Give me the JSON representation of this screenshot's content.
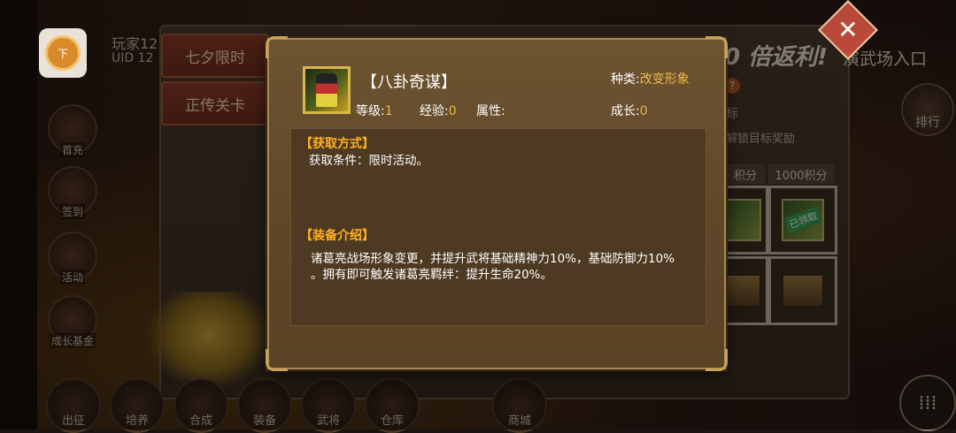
{
  "player": {
    "name": "玩家12",
    "uid": "UID 12",
    "avatar_char": "下"
  },
  "left_menu": [
    {
      "label": "首充"
    },
    {
      "label": "签到"
    },
    {
      "label": "活动"
    },
    {
      "label": "成长基金"
    }
  ],
  "bottom_menu": [
    {
      "label": "出征"
    },
    {
      "label": "培养"
    },
    {
      "label": "合成"
    },
    {
      "label": "装备"
    },
    {
      "label": "武将"
    },
    {
      "label": "仓库"
    },
    {
      "label": "商城"
    }
  ],
  "event": {
    "tabs": [
      "七夕限时",
      "正传关卡"
    ],
    "rebate_text": "0 倍返利!",
    "entrance_text": "演武场入口",
    "goal_text": "标",
    "unlock_text": "解锁目标奖励",
    "score_headers": [
      "积分",
      "1000积分"
    ],
    "claimed_label": "已领取",
    "rank_label": "排行"
  },
  "modal": {
    "title": "【八卦奇谋】",
    "type_label": "种类:",
    "type_value": "改变形象",
    "level_label": "等级:",
    "level_value": "1",
    "exp_label": "经验:",
    "exp_value": "0",
    "attr_label": "属性:",
    "attr_value": "",
    "growth_label": "成长:",
    "growth_value": "0",
    "acquire_head": "【获取方式】",
    "acquire_body": "获取条件：限时活动。",
    "intro_head": "【装备介绍】",
    "intro_line1": "诸葛亮战场形象变更，并提升武将基础精神力10%，基础防御力10%",
    "intro_line2": "。拥有即可触发诸葛亮羁绊：提升生命20%。"
  },
  "colors": {
    "accent_gold": "#f2b94a",
    "section_orange": "#ffb020"
  }
}
